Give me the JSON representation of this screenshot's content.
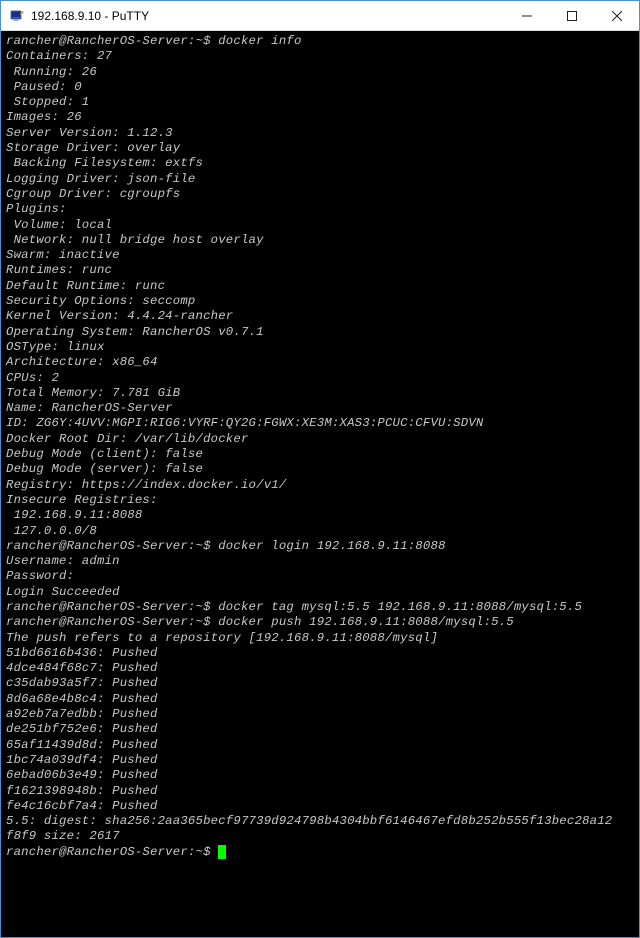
{
  "titlebar": {
    "title": "192.168.9.10 - PuTTY"
  },
  "prompt": "rancher@RancherOS-Server:~$ ",
  "commands": {
    "c0": "docker info",
    "c1": "docker login 192.168.9.11:8088",
    "c2": "docker tag mysql:5.5 192.168.9.11:8088/mysql:5.5",
    "c3": "docker push 192.168.9.11:8088/mysql:5.5"
  },
  "output": {
    "info": [
      "Containers: 27",
      " Running: 26",
      " Paused: 0",
      " Stopped: 1",
      "Images: 26",
      "Server Version: 1.12.3",
      "Storage Driver: overlay",
      " Backing Filesystem: extfs",
      "Logging Driver: json-file",
      "Cgroup Driver: cgroupfs",
      "Plugins:",
      " Volume: local",
      " Network: null bridge host overlay",
      "Swarm: inactive",
      "Runtimes: runc",
      "Default Runtime: runc",
      "Security Options: seccomp",
      "Kernel Version: 4.4.24-rancher",
      "Operating System: RancherOS v0.7.1",
      "OSType: linux",
      "Architecture: x86_64",
      "CPUs: 2",
      "Total Memory: 7.781 GiB",
      "Name: RancherOS-Server",
      "ID: ZG6Y:4UVV:MGPI:RIG6:VYRF:QY2G:FGWX:XE3M:XAS3:PCUC:CFVU:SDVN",
      "Docker Root Dir: /var/lib/docker",
      "Debug Mode (client): false",
      "Debug Mode (server): false",
      "Registry: https://index.docker.io/v1/",
      "Insecure Registries:",
      " 192.168.9.11:8088",
      " 127.0.0.0/8"
    ],
    "login": [
      "Username: admin",
      "Password:",
      "Login Succeeded"
    ],
    "push": [
      "The push refers to a repository [192.168.9.11:8088/mysql]",
      "51bd6616b436: Pushed",
      "4dce484f68c7: Pushed",
      "c35dab93a5f7: Pushed",
      "8d6a68e4b8c4: Pushed",
      "a92eb7a7edbb: Pushed",
      "de251bf752e6: Pushed",
      "65af11439d8d: Pushed",
      "1bc74a039df4: Pushed",
      "6ebad06b3e49: Pushed",
      "f1621398948b: Pushed",
      "fe4c16cbf7a4: Pushed",
      "5.5: digest: sha256:2aa365becf97739d924798b4304bbf6146467efd8b252b555f13bec28a12",
      "f8f9 size: 2617"
    ]
  }
}
